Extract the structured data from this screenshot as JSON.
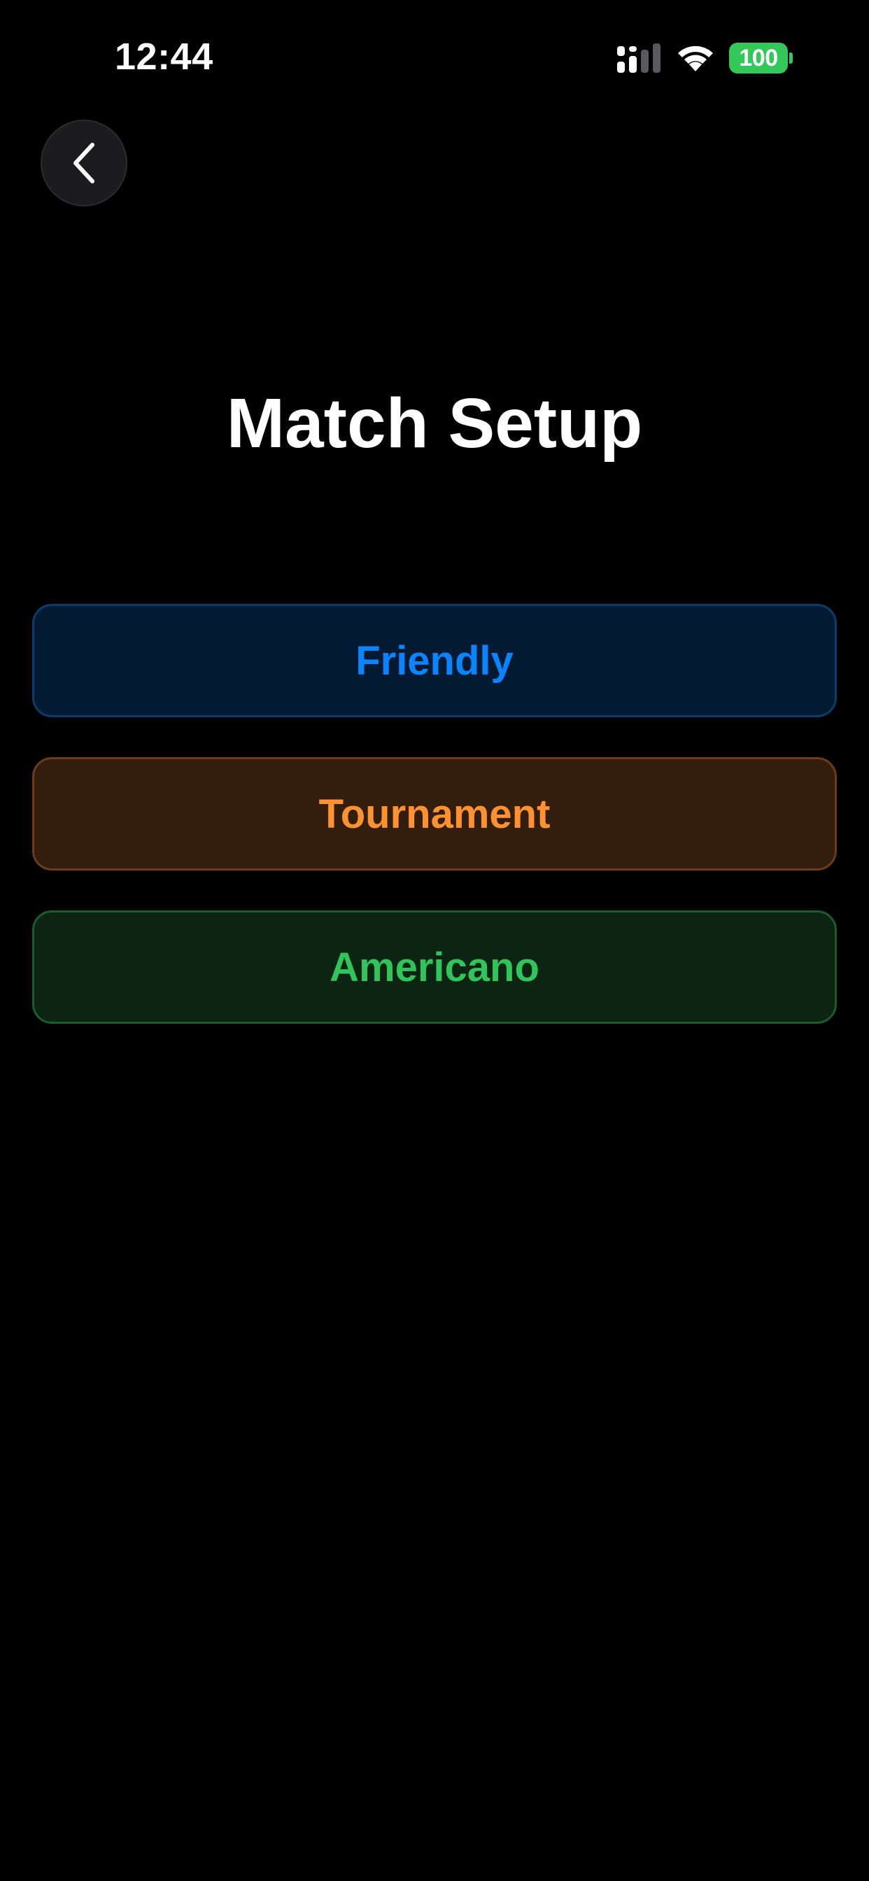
{
  "status_bar": {
    "time": "12:44",
    "battery_level": "100",
    "icons": [
      "signal-icon",
      "wifi-icon",
      "battery-icon"
    ]
  },
  "navigation": {
    "back_icon": "chevron-left-icon"
  },
  "page": {
    "title": "Match Setup"
  },
  "modes": [
    {
      "label": "Friendly",
      "accent": "#0a84ff"
    },
    {
      "label": "Tournament",
      "accent": "#ff9230"
    },
    {
      "label": "Americano",
      "accent": "#30c45a"
    }
  ]
}
